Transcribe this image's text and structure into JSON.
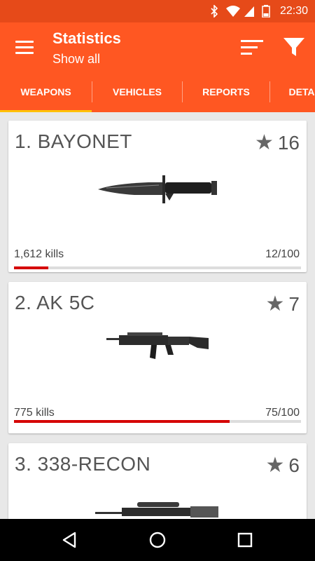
{
  "status_bar": {
    "time": "22:30",
    "icons": [
      "bluetooth-icon",
      "wifi-icon",
      "signal-icon",
      "battery-icon"
    ]
  },
  "app_bar": {
    "title": "Statistics",
    "subtitle": "Show all",
    "icons": [
      "menu-icon",
      "sort-icon",
      "filter-icon"
    ]
  },
  "tabs": [
    {
      "label": "WEAPONS",
      "selected": true
    },
    {
      "label": "VEHICLES",
      "selected": false
    },
    {
      "label": "REPORTS",
      "selected": false
    },
    {
      "label": "DETA",
      "selected": false
    }
  ],
  "weapons": [
    {
      "title": "1. BAYONET",
      "rating": "16",
      "kills": "1,612 kills",
      "progress": "12/100",
      "progress_value": 12,
      "image": "bayonet-knife"
    },
    {
      "title": "2. AK 5C",
      "rating": "7",
      "kills": "775 kills",
      "progress": "75/100",
      "progress_value": 75,
      "image": "assault-rifle"
    },
    {
      "title": "3. 338-RECON",
      "rating": "6",
      "image": "sniper-rifle"
    }
  ],
  "colors": {
    "primary": "#ff5722",
    "status_bar": "#e64a19",
    "tab_indicator": "#ffc107",
    "progress": "#d50000"
  },
  "nav_bar": {
    "icons": [
      "back-icon",
      "home-icon",
      "recents-icon"
    ]
  }
}
